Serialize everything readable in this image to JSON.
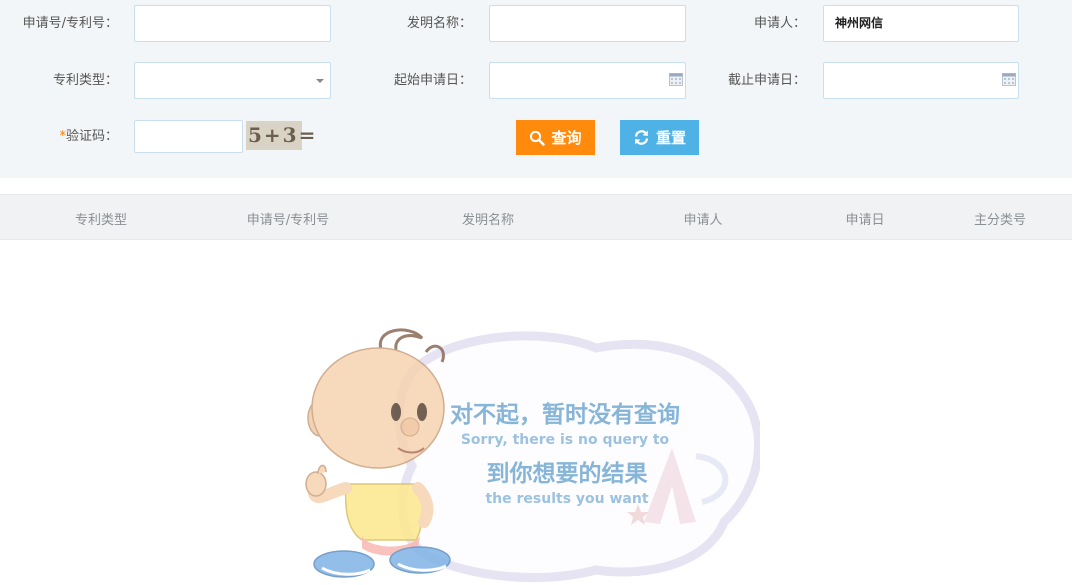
{
  "form": {
    "app_no_label": "申请号/专利号：",
    "app_no_value": "",
    "title_label": "发明名称：",
    "title_value": "",
    "applicant_label": "申请人：",
    "applicant_value": "神州网信",
    "patent_type_label": "专利类型：",
    "patent_type_value": "",
    "start_date_label": "起始申请日：",
    "start_date_value": "",
    "end_date_label": "截止申请日：",
    "end_date_value": "",
    "captcha_required_mark": "*",
    "captcha_label": "验证码：",
    "captcha_value": "",
    "captcha_image_text": "5+3="
  },
  "buttons": {
    "query_label": "查询",
    "reset_label": "重置"
  },
  "table": {
    "headers": [
      "专利类型",
      "申请号/专利号",
      "发明名称",
      "申请人",
      "申请日",
      "主分类号"
    ]
  },
  "empty_state": {
    "line1": "对不起，暂时没有查询",
    "line2": "Sorry, there is no query to",
    "line3": "到你想要的结果",
    "line4": "the results you want"
  },
  "colors": {
    "accent_query": "#ff8a0c",
    "accent_reset": "#4fb2e6",
    "form_bg": "#f3f6f8",
    "input_border": "#c9dfee",
    "required": "#ff7a00"
  },
  "icons": {
    "query": "search-icon",
    "reset": "refresh-icon",
    "date": "calendar-icon",
    "select": "chevron-down-icon"
  }
}
